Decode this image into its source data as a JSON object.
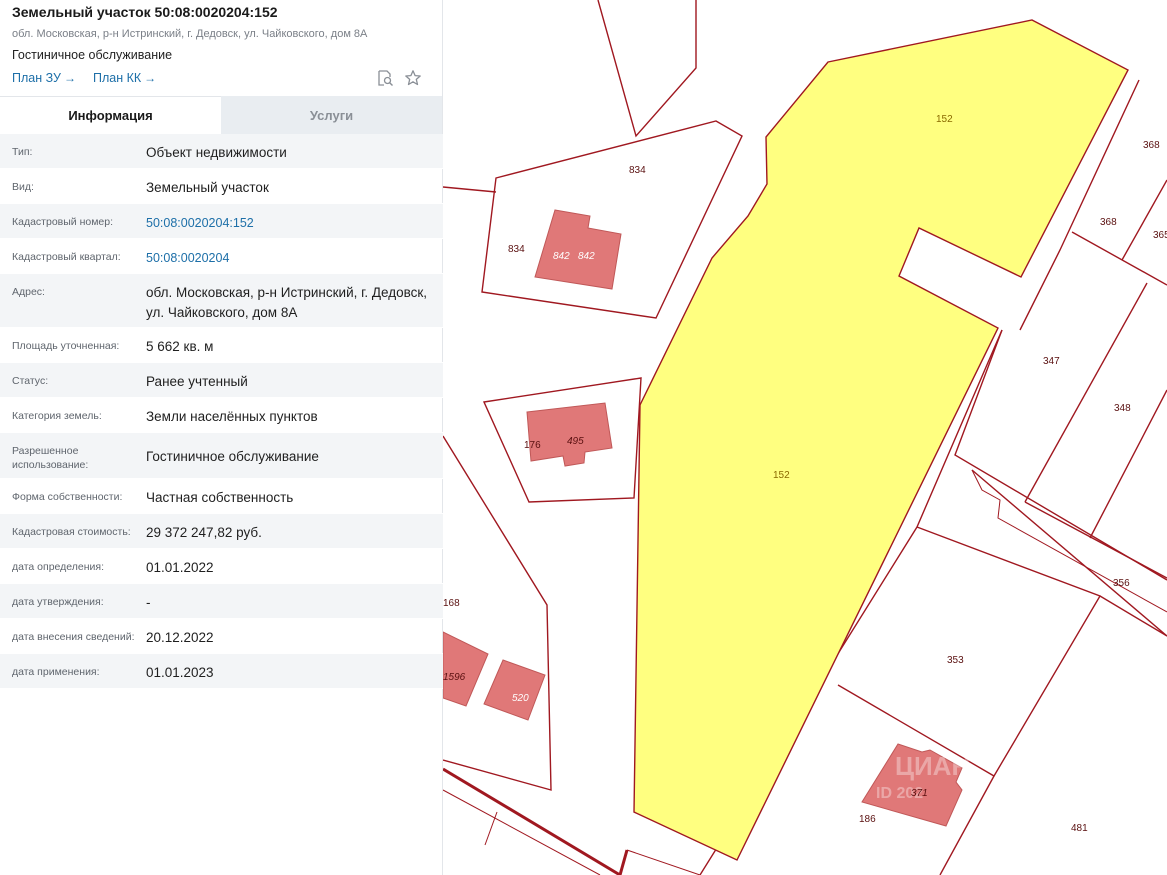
{
  "header": {
    "title": "Земельный участок 50:08:0020204:152",
    "address": "обл. Московская, р-н Истринский, г. Дедовск, ул. Чайковского, дом 8А",
    "purpose": "Гостиничное обслуживание",
    "links": [
      "План ЗУ",
      "План КК"
    ],
    "link_arrow": "→"
  },
  "tabs": {
    "info": "Информация",
    "services": "Услуги"
  },
  "fields": [
    {
      "key": "Тип:",
      "value": "Объект недвижимости"
    },
    {
      "key": "Вид:",
      "value": "Земельный участок"
    },
    {
      "key": "Кадастровый номер:",
      "value": "50:08:0020204:152"
    },
    {
      "key": "Кадастровый квартал:",
      "value": "50:08:0020204"
    },
    {
      "key": "Адрес:",
      "value": "обл. Московская, р-н Истринский, г. Дедовск, ул. Чайковского, дом 8А"
    },
    {
      "key": "Площадь уточненная:",
      "value": "5 662 кв. м"
    },
    {
      "key": "Статус:",
      "value": "Ранее учтенный"
    },
    {
      "key": "Категория земель:",
      "value": "Земли населённых пунктов"
    },
    {
      "key": "Разрешенное использование:",
      "value": "Гостиничное обслуживание"
    },
    {
      "key": "Форма собственности:",
      "value": "Частная собственность"
    },
    {
      "key": "Кадастровая стоимость:",
      "value": "29 372 247,82 руб."
    },
    {
      "key": "дата определения:",
      "value": "01.01.2022"
    },
    {
      "key": "дата утверждения:",
      "value": "-"
    },
    {
      "key": "дата внесения сведений:",
      "value": "20.12.2022"
    },
    {
      "key": "дата применения:",
      "value": "01.01.2023"
    }
  ],
  "icons": {
    "plan": "document-search-icon",
    "favorite": "star-icon"
  },
  "map": {
    "colors": {
      "boundary": "#a01820",
      "highlight_fill": "#ffff80",
      "building": "#e07878",
      "label": "#5a1010",
      "highlight_label": "#8a6a00"
    },
    "labels": {
      "main_top": "152",
      "main_center": "152",
      "p834a": "834",
      "p834b": "834",
      "b842a": "842",
      "b842b": "842",
      "p176": "176",
      "b495": "495",
      "p168": "168",
      "b1596": "1596",
      "b520": "520",
      "p368a": "368",
      "p368b": "368",
      "p365": "365",
      "p347": "347",
      "p348": "348",
      "p356": "356",
      "p353": "353",
      "p371": "371",
      "p186": "186",
      "p481": "481"
    },
    "watermark": "ЦИАН",
    "watermark_id": "ID 202"
  }
}
